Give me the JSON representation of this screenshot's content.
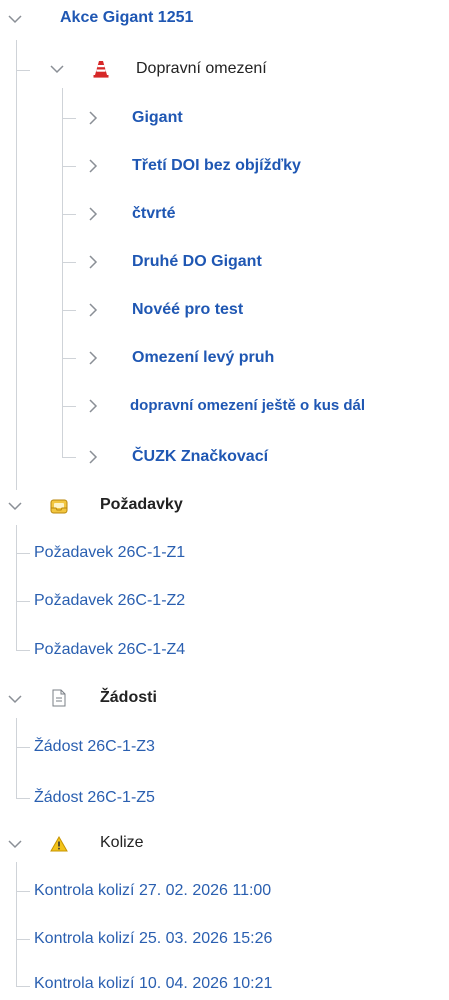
{
  "root": {
    "label": "Akce Gigant 1251"
  },
  "traffic": {
    "label": "Dopravní omezení",
    "icon": "traffic-cone-icon",
    "items": [
      "Gigant",
      "Třetí DOI bez objížďky",
      "čtvrté",
      "Druhé DO Gigant",
      "Novéé pro test",
      "Omezení levý pruh",
      "dopravní omezení ještě o kus dál",
      "ČUZK Značkovací"
    ]
  },
  "requirements": {
    "label": "Požadavky",
    "icon": "inbox-tray-icon",
    "items": [
      "Požadavek 26C-1-Z1",
      "Požadavek 26C-1-Z2",
      "Požadavek 26C-1-Z4"
    ]
  },
  "applications": {
    "label": "Žádosti",
    "icon": "document-icon",
    "items": [
      "Žádost 26C-1-Z3",
      "Žádost 26C-1-Z5"
    ]
  },
  "collisions": {
    "label": "Kolize",
    "icon": "warning-triangle-icon",
    "items": [
      "Kontrola kolizí 27. 02. 2026 11:00",
      "Kontrola kolizí 25. 03. 2026 15:26",
      "Kontrola kolizí 10. 04. 2026 10:21"
    ]
  },
  "colors": {
    "link": "#2a5fb0",
    "link_bold": "#1f57b3",
    "guide": "#cfd3d8",
    "chevron": "#8a8f96",
    "cone": "#d62828",
    "warning": "#f2c31b"
  }
}
